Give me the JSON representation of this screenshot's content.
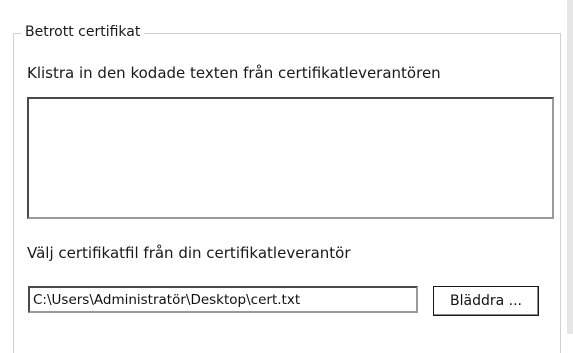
{
  "group": {
    "title": "Betrott certifikat"
  },
  "paste": {
    "label": "Klistra in den kodade texten från certifikatleverantören",
    "value": ""
  },
  "file": {
    "label": "Välj certifikatfil från din certifikatleverantör",
    "path": "C:\\Users\\Administratör\\Desktop\\cert.txt",
    "browse_label": "Bläddra ..."
  }
}
